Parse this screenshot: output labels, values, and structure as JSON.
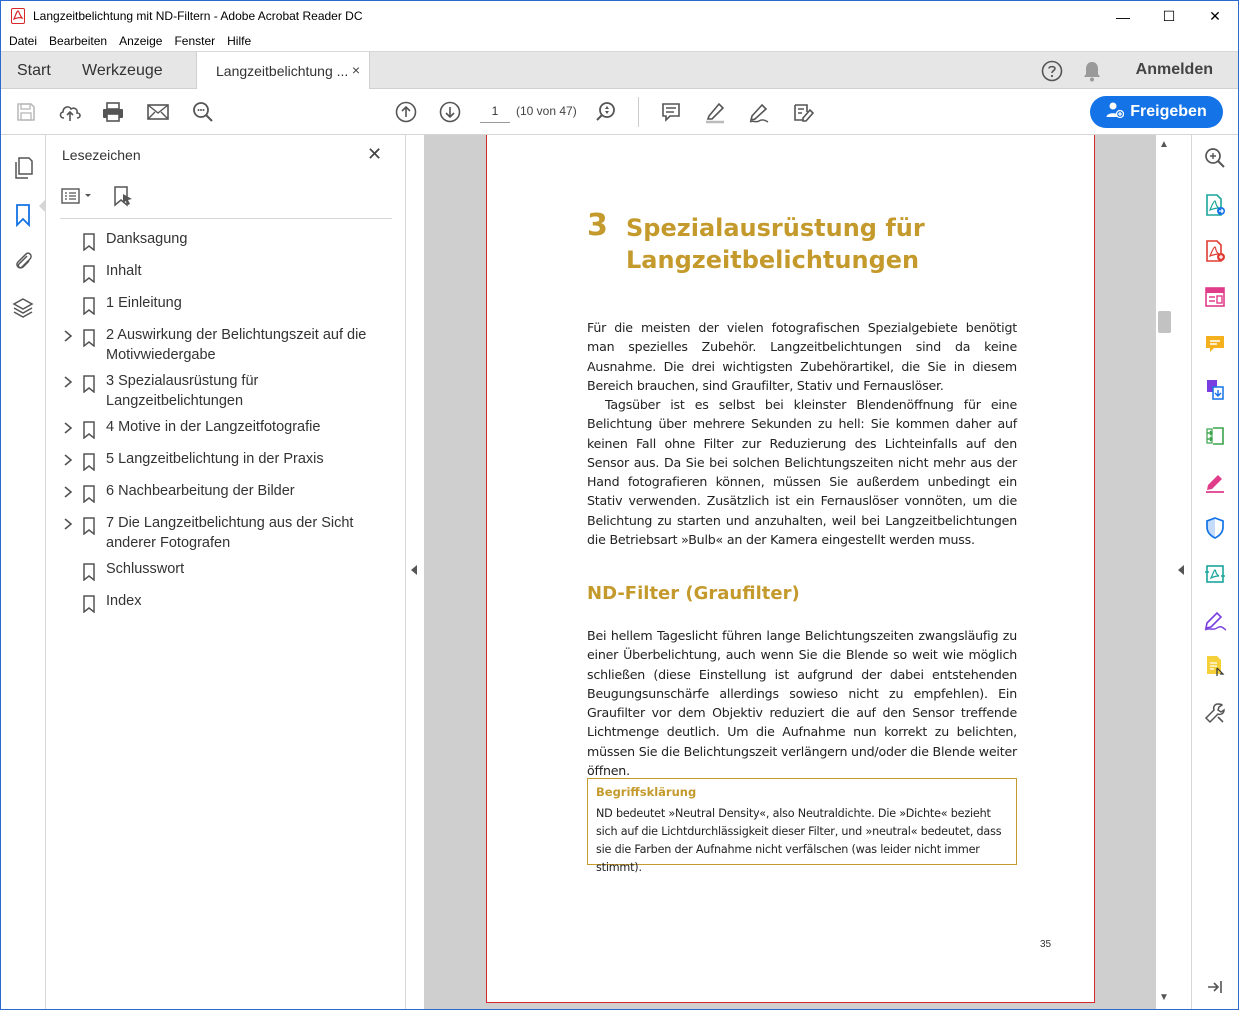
{
  "window": {
    "title": "Langzeitbelichtung mit ND-Filtern - Adobe Acrobat Reader DC",
    "minimize": "—",
    "maximize": "☐",
    "close": "✕"
  },
  "menu": [
    "Datei",
    "Bearbeiten",
    "Anzeige",
    "Fenster",
    "Hilfe"
  ],
  "tabs": {
    "start": "Start",
    "tools": "Werkzeuge",
    "document": "Langzeitbelichtung ...",
    "document_close": "×",
    "signin": "Anmelden"
  },
  "toolbar": {
    "page_value": "1",
    "page_count": "(10 von 47)",
    "share_label": "Freigeben"
  },
  "bookmarks": {
    "title": "Lesezeichen",
    "close": "✕",
    "items": [
      {
        "label": "Danksagung",
        "expandable": false
      },
      {
        "label": "Inhalt",
        "expandable": false
      },
      {
        "label": "1 Einleitung",
        "expandable": false
      },
      {
        "label": "2 Auswirkung der Belichtungszeit auf die Motivwiedergabe",
        "expandable": true
      },
      {
        "label": "3 Spezialausrüstung für Langzeitbelichtungen",
        "expandable": true
      },
      {
        "label": "4 Motive in der Langzeitfotografie",
        "expandable": true
      },
      {
        "label": "5 Langzeitbelichtung in der Praxis",
        "expandable": true
      },
      {
        "label": "6 Nachbearbeitung der Bilder",
        "expandable": true
      },
      {
        "label": "7 Die Langzeitbelichtung aus der Sicht anderer Fotografen",
        "expandable": true
      },
      {
        "label": "Schlusswort",
        "expandable": false
      },
      {
        "label": "Index",
        "expandable": false
      }
    ]
  },
  "page": {
    "chapter_number": "3",
    "chapter_title_line1": "Spezialausrüstung für",
    "chapter_title_line2": "Langzeitbelichtungen",
    "paragraph1": "Für die meisten der vielen fotografischen Spezialgebiete benötigt man spezielles Zubehör. Langzeitbelichtungen sind da keine Ausnahme. Die drei wichtigsten Zubehörartikel, die Sie in diesem Bereich brauchen, sind Graufilter, Stativ und Fernauslöser.",
    "paragraph2": "Tagsüber ist es selbst bei kleinster Blendenöffnung für eine Belichtung über mehrere Sekunden zu hell: Sie kommen daher auf keinen Fall ohne Filter zur Reduzierung des Lichteinfalls auf den Sensor aus. Da Sie bei solchen Belichtungszeiten nicht mehr aus der Hand fotografieren können, müssen Sie außerdem unbedingt ein Stativ verwenden. Zusätzlich ist ein Fernauslöser vonnöten, um die Belichtung zu starten und anzuhalten, weil bei Langzeitbelichtungen die Betriebsart »Bulb« an der Kamera eingestellt werden muss.",
    "section_title": "ND-Filter (Graufilter)",
    "paragraph3": "Bei hellem Tageslicht führen lange Belichtungszeiten zwangsläufig zu einer Überbelichtung, auch wenn Sie die Blende so weit wie möglich schließen (diese Einstellung ist aufgrund der dabei entstehenden Beugungsunschärfe allerdings sowieso nicht zu empfehlen). Ein Graufilter vor dem Objektiv reduziert die auf den Sensor treffende Lichtmenge deutlich. Um die Aufnahme nun korrekt zu belichten, müssen Sie die Belichtungszeit verlängern und/oder die Blende weiter öffnen.",
    "box_title": "Begriffsklärung",
    "box_text": "ND bedeutet »Neutral Density«, also Neutraldichte. Die »Dichte« bezieht sich auf die Lichtdurchlässigkeit dieser Filter, und »neutral« bedeutet, dass sie die Farben der Aufnahme nicht verfälschen (was leider nicht immer stimmt).",
    "page_number": "35"
  },
  "colors": {
    "accent_gold": "#c49a2c",
    "share_blue": "#1473e6",
    "page_border": "#d6282b"
  }
}
